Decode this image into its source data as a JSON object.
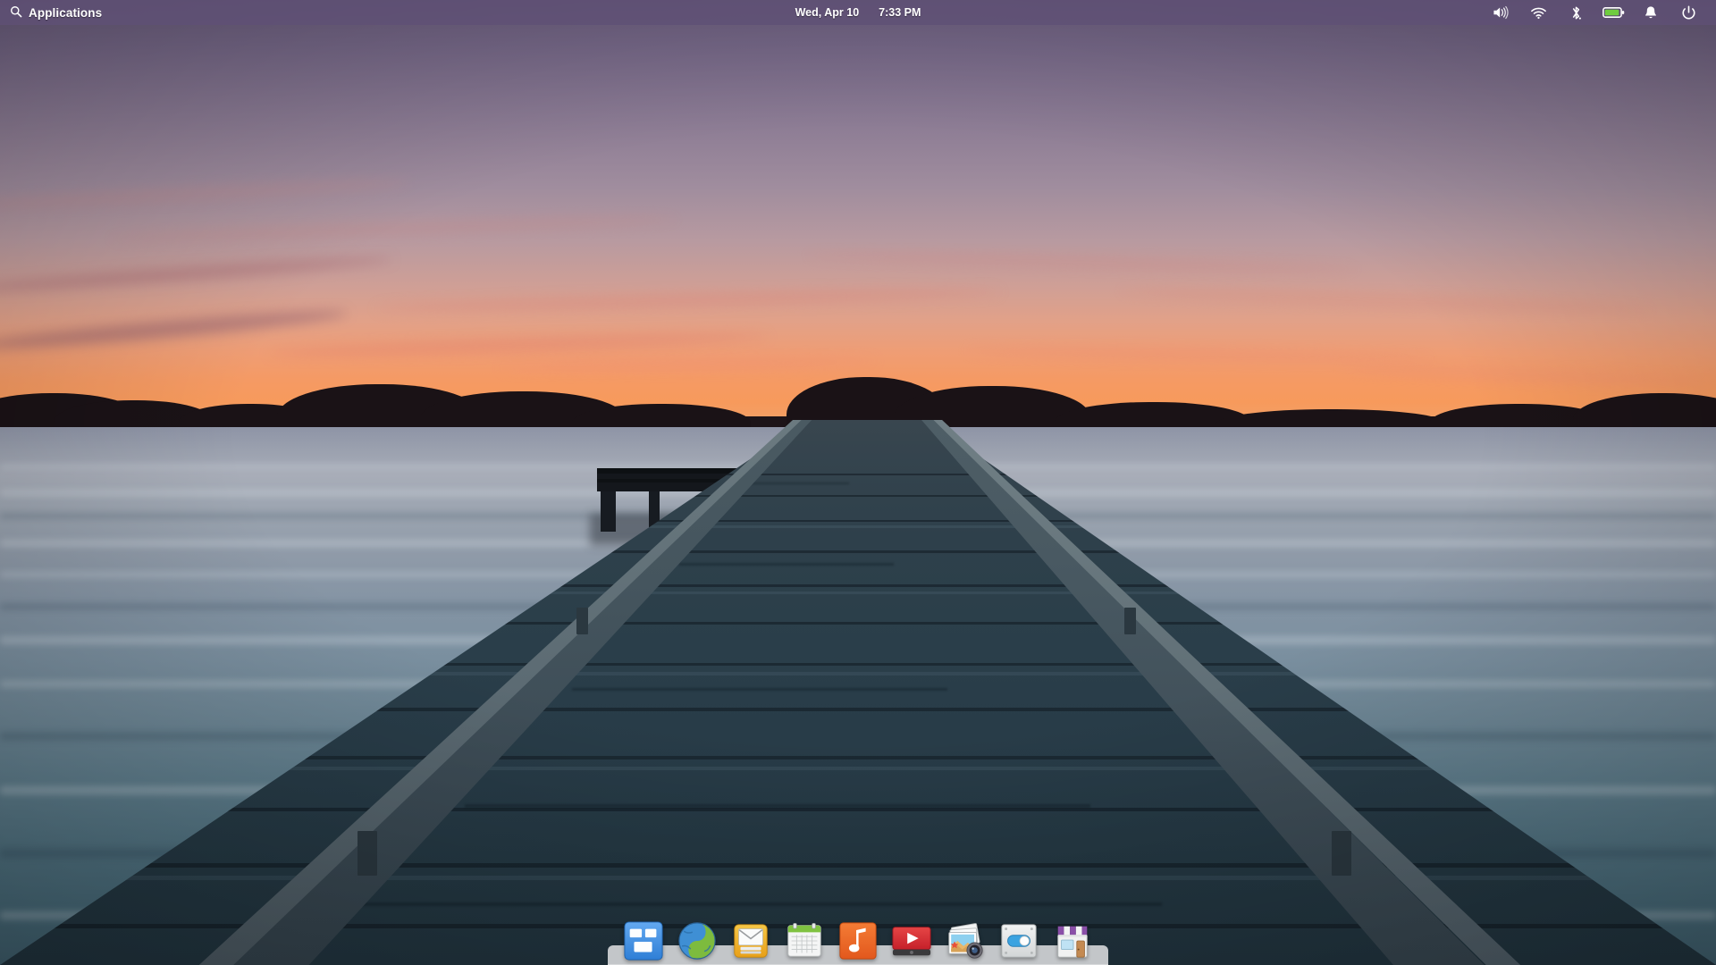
{
  "desktop": {
    "environment": "Pantheon desktop",
    "wallpaper": {
      "name": "sunset-pier-wallpaper",
      "description": "Wooden pier over calm water at sunset",
      "sky_top_color": "#6b5d7d",
      "sky_horizon_color": "#f79a5c",
      "water_top_color": "#8e94a6",
      "water_bottom_color": "#426372",
      "pier_color": "#2b3f4a"
    }
  },
  "panel": {
    "background_color": "#5f5076",
    "applications": {
      "label": "Applications",
      "icon": "search-icon"
    },
    "clock": {
      "date": "Wed, Apr 10",
      "time": "7:33 PM"
    },
    "indicators": [
      {
        "name": "volume-icon",
        "label": "Sound"
      },
      {
        "name": "wifi-icon",
        "label": "Network"
      },
      {
        "name": "bluetooth-icon",
        "label": "Bluetooth"
      },
      {
        "name": "battery-icon",
        "label": "Power",
        "fill_color": "#6fcc3f"
      },
      {
        "name": "notification-icon",
        "label": "Notifications"
      },
      {
        "name": "power-icon",
        "label": "System"
      }
    ]
  },
  "dock": {
    "background_color": "#dee0e2",
    "items": [
      {
        "name": "dock-item-files",
        "label": "Files"
      },
      {
        "name": "dock-item-web",
        "label": "Web Browser"
      },
      {
        "name": "dock-item-mail",
        "label": "Mail"
      },
      {
        "name": "dock-item-calendar",
        "label": "Calendar"
      },
      {
        "name": "dock-item-music",
        "label": "Music"
      },
      {
        "name": "dock-item-videos",
        "label": "Videos"
      },
      {
        "name": "dock-item-photos",
        "label": "Photos"
      },
      {
        "name": "dock-item-settings",
        "label": "System Settings"
      },
      {
        "name": "dock-item-appcenter",
        "label": "AppCenter"
      }
    ]
  }
}
